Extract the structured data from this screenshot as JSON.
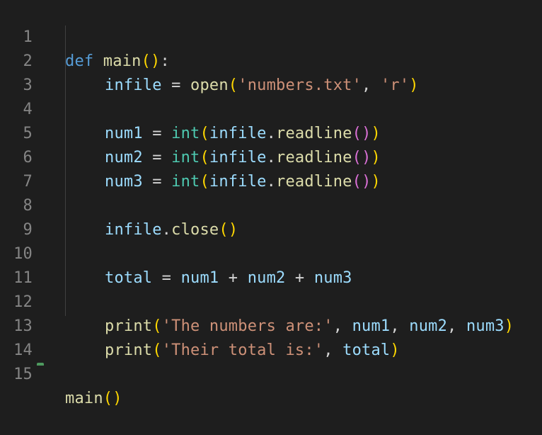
{
  "editor": {
    "line_numbers": [
      "1",
      "2",
      "3",
      "4",
      "5",
      "6",
      "7",
      "8",
      "9",
      "10",
      "11",
      "12",
      "13",
      "14",
      "15"
    ],
    "tokens": {
      "l1": {
        "def": "def",
        "name": "main",
        "open": "(",
        "close": ")",
        "colon": ":"
      },
      "l2": {
        "var": "infile",
        "eq": " = ",
        "fn": "open",
        "open": "(",
        "arg1": "'numbers.txt'",
        "comma": ", ",
        "arg2": "'r'",
        "close": ")"
      },
      "l4": {
        "var": "num1",
        "eq": " = ",
        "cls": "int",
        "open": "(",
        "obj": "infile",
        "dot": ".",
        "method": "readline",
        "open2": "(",
        "close2": ")",
        "close": ")"
      },
      "l5": {
        "var": "num2",
        "eq": " = ",
        "cls": "int",
        "open": "(",
        "obj": "infile",
        "dot": ".",
        "method": "readline",
        "open2": "(",
        "close2": ")",
        "close": ")"
      },
      "l6": {
        "var": "num3",
        "eq": " = ",
        "cls": "int",
        "open": "(",
        "obj": "infile",
        "dot": ".",
        "method": "readline",
        "open2": "(",
        "close2": ")",
        "close": ")"
      },
      "l8": {
        "obj": "infile",
        "dot": ".",
        "method": "close",
        "open": "(",
        "close": ")"
      },
      "l10": {
        "var": "total",
        "eq": " = ",
        "a": "num1",
        "plus1": " + ",
        "b": "num2",
        "plus2": " + ",
        "c": "num3"
      },
      "l12": {
        "fn": "print",
        "open": "(",
        "str": "'The numbers are:'",
        "c1": ", ",
        "a": "num1",
        "c2": ", ",
        "b": "num2",
        "c3": ", ",
        "c": "num3",
        "close": ")"
      },
      "l13": {
        "fn": "print",
        "open": "(",
        "str": "'Their total is:'",
        "c1": ", ",
        "a": "total",
        "close": ")"
      },
      "l15": {
        "fn": "main",
        "open": "(",
        "close": ")"
      }
    }
  },
  "colors": {
    "background": "#1e1e1e",
    "line_number": "#858585",
    "keyword": "#569cd6",
    "function": "#dcdcaa",
    "variable": "#9cdcfe",
    "string": "#ce9178",
    "class": "#4ec9b0",
    "bracket_level1": "#ffd700",
    "bracket_level2": "#da70d6"
  }
}
